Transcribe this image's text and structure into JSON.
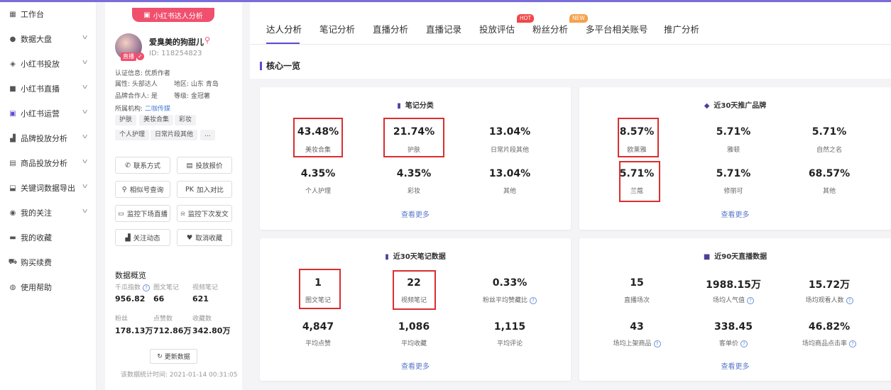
{
  "sidebar": {
    "items": [
      {
        "label": "工作台",
        "icon": "grid-icon"
      },
      {
        "label": "数据大盘",
        "icon": "pie-icon"
      },
      {
        "label": "小红书投放",
        "icon": "shield-icon"
      },
      {
        "label": "小红书直播",
        "icon": "video-icon"
      },
      {
        "label": "小红书运营",
        "icon": "chat-icon"
      },
      {
        "label": "品牌投放分析",
        "icon": "chart-icon"
      },
      {
        "label": "商品投放分析",
        "icon": "bag-icon"
      },
      {
        "label": "关键词数据导出",
        "icon": "export-icon"
      },
      {
        "label": "我的关注",
        "icon": "eye-icon"
      },
      {
        "label": "我的收藏",
        "icon": "box-icon"
      },
      {
        "label": "购买续费",
        "icon": "cart-icon"
      },
      {
        "label": "使用帮助",
        "icon": "help-icon"
      }
    ]
  },
  "profile": {
    "pill": "小红书达人分析",
    "live_badge": "直播",
    "name": "爱臭美的狗甜儿",
    "id_line": "ID: 118254823",
    "cert": "认证信息: 优质作者",
    "attr": "属性: 头部达人",
    "region": "地区: 山东 青岛",
    "brand_coop": "品牌合作人: 是",
    "level": "等级: 金冠薯",
    "org_label": "所属机构:",
    "org_value": "二咖传媒",
    "tags": [
      "护肤",
      "美妆合集",
      "彩妆",
      "个人护理",
      "日常片段其他",
      "..."
    ],
    "buttons": [
      "联系方式",
      "投放报价",
      "相似号查询",
      "加入对比",
      "监控下场直播",
      "监控下次发文",
      "关注动态",
      "取消收藏"
    ],
    "compare_prefix": "PK",
    "overview_title": "数据概览",
    "overview": [
      {
        "label": "千瓜指数",
        "value": "956.82"
      },
      {
        "label": "图文笔记",
        "value": "66"
      },
      {
        "label": "视频笔记",
        "value": "621"
      },
      {
        "label": "粉丝",
        "value": "178.13万"
      },
      {
        "label": "点赞数",
        "value": "712.86万"
      },
      {
        "label": "收藏数",
        "value": "342.80万"
      }
    ],
    "refresh": "更新数据",
    "stat_time": "该数据统计时间: 2021-01-14 00:31:05"
  },
  "tabs": [
    {
      "label": "达人分析"
    },
    {
      "label": "笔记分析"
    },
    {
      "label": "直播分析"
    },
    {
      "label": "直播记录"
    },
    {
      "label": "投放评估"
    },
    {
      "label": "粉丝分析",
      "badge": "HOT"
    },
    {
      "label": "多平台相关账号",
      "badge": "NEW"
    },
    {
      "label": "推广分析"
    }
  ],
  "section_title": "核心一览",
  "help_mark": "?",
  "cards": [
    {
      "title": "笔记分类",
      "metrics": [
        {
          "value": "43.48%",
          "label": "美妆合集"
        },
        {
          "value": "21.74%",
          "label": "护肤"
        },
        {
          "value": "13.04%",
          "label": "日常片段其他"
        },
        {
          "value": "4.35%",
          "label": "个人护理"
        },
        {
          "value": "4.35%",
          "label": "彩妆"
        },
        {
          "value": "13.04%",
          "label": "其他"
        }
      ],
      "more": "查看更多"
    },
    {
      "title": "近30天推广品牌",
      "metrics": [
        {
          "value": "8.57%",
          "label": "欧莱雅"
        },
        {
          "value": "5.71%",
          "label": "雅顿"
        },
        {
          "value": "5.71%",
          "label": "自然之名"
        },
        {
          "value": "5.71%",
          "label": "兰蔻"
        },
        {
          "value": "5.71%",
          "label": "修丽可"
        },
        {
          "value": "68.57%",
          "label": "其他"
        }
      ],
      "more": "查看更多"
    },
    {
      "title": "近30天笔记数据",
      "metrics": [
        {
          "value": "1",
          "label": "图文笔记"
        },
        {
          "value": "22",
          "label": "视频笔记"
        },
        {
          "value": "0.33%",
          "label": "粉丝平均赞藏比"
        },
        {
          "value": "4,847",
          "label": "平均点赞"
        },
        {
          "value": "1,086",
          "label": "平均收藏"
        },
        {
          "value": "1,115",
          "label": "平均评论"
        }
      ],
      "more": "查看更多"
    },
    {
      "title": "近90天直播数据",
      "metrics": [
        {
          "value": "15",
          "label": "直播场次"
        },
        {
          "value": "1988.15万",
          "label": "场均人气值"
        },
        {
          "value": "15.72万",
          "label": "场均观看人数"
        },
        {
          "value": "43",
          "label": "场均上架商品"
        },
        {
          "value": "338.45",
          "label": "客单价"
        },
        {
          "value": "46.82%",
          "label": "场均商品点击率"
        }
      ],
      "more": "查看更多"
    }
  ]
}
